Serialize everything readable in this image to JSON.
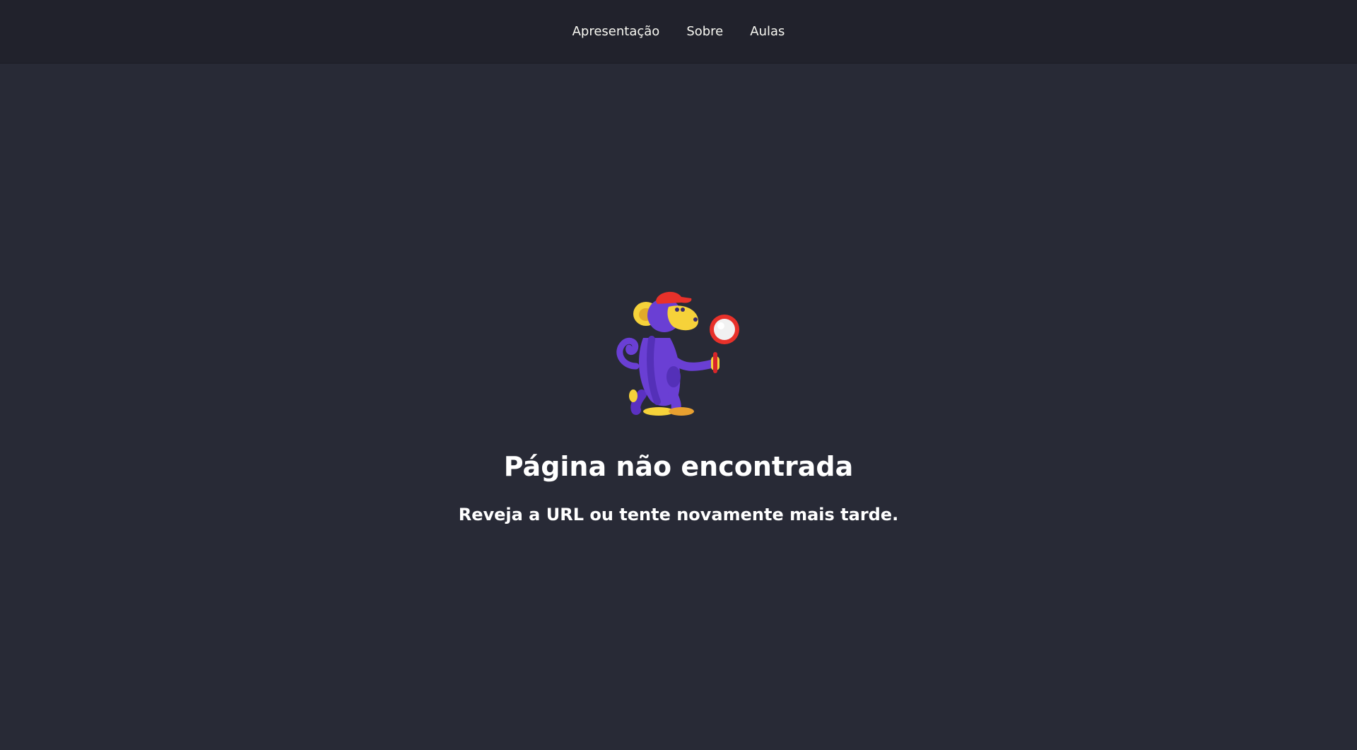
{
  "nav": {
    "items": [
      {
        "label": "Apresentação"
      },
      {
        "label": "Sobre"
      },
      {
        "label": "Aulas"
      }
    ]
  },
  "error": {
    "title": "Página não encontrada",
    "message": "Reveja a URL ou tente novamente mais tarde."
  },
  "illustration": {
    "icon": "monkey-magnifying-glass-icon"
  },
  "colors": {
    "header_bg": "#21222c",
    "page_bg": "#282a36",
    "text": "#ffffff",
    "monkey_body": "#6a3fd4",
    "monkey_face": "#f6d23a",
    "cap": "#e8312a"
  }
}
